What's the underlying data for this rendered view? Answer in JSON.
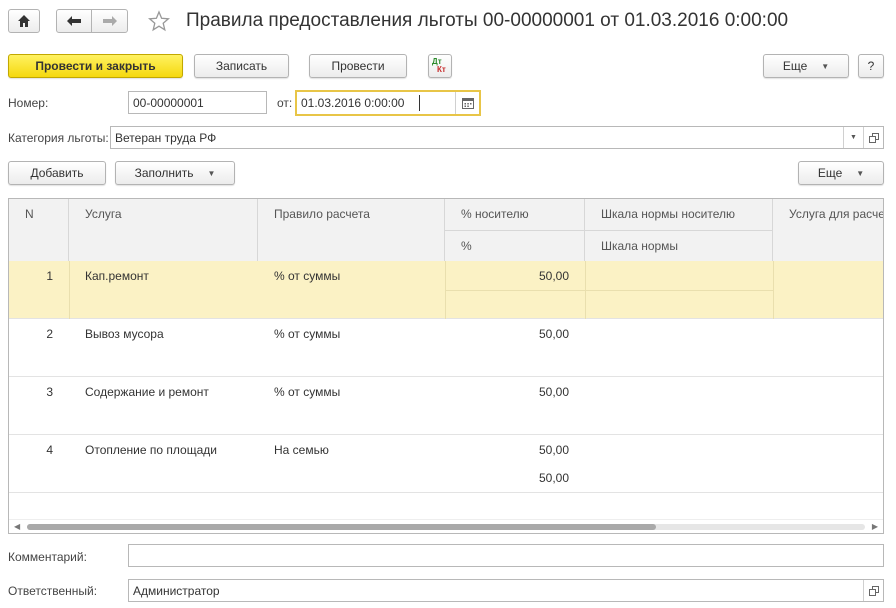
{
  "window": {
    "title": "Правила предоставления льготы 00-00000001 от 01.03.2016 0:00:00"
  },
  "toolbar": {
    "post_close": "Провести и закрыть",
    "save": "Записать",
    "post": "Провести",
    "dt_label": "Дт",
    "kt_label": "Кт",
    "more": "Еще",
    "help": "?"
  },
  "form": {
    "number_label": "Номер:",
    "number_value": "00-00000001",
    "date_label": "от:",
    "date_value": "01.03.2016  0:00:00",
    "category_label": "Категория льготы:",
    "category_value": "Ветеран труда РФ",
    "comment_label": "Комментарий:",
    "comment_value": "",
    "responsible_label": "Ответственный:",
    "responsible_value": "Администратор"
  },
  "table_toolbar": {
    "add": "Добавить",
    "fill": "Заполнить",
    "more": "Еще"
  },
  "table": {
    "columns": {
      "n": "N",
      "service": "Услуга",
      "rule": "Правило расчета",
      "pct": "% носителю",
      "pct_sub": "%",
      "scale": "Шкала нормы носителю",
      "scale_sub": "Шкала нормы",
      "service_calc": "Услуга для расчета"
    },
    "rows": [
      {
        "n": "1",
        "service": "Кап.ремонт",
        "rule": "% от суммы",
        "pct": "50,00",
        "pct2": ""
      },
      {
        "n": "2",
        "service": "Вывоз мусора",
        "rule": "% от суммы",
        "pct": "50,00",
        "pct2": ""
      },
      {
        "n": "3",
        "service": "Содержание и ремонт",
        "rule": "% от суммы",
        "pct": "50,00",
        "pct2": ""
      },
      {
        "n": "4",
        "service": "Отопление по площади",
        "rule": "На семью",
        "pct": "50,00",
        "pct2": "50,00"
      }
    ],
    "selected_row": 1
  },
  "colors": {
    "primary_button": "#f5d80f",
    "selected_row": "#fbf2c5",
    "focus_border": "#e8c547"
  }
}
